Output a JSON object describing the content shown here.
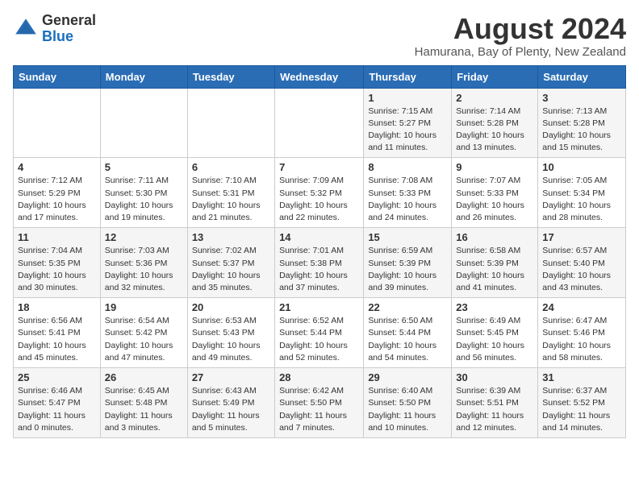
{
  "header": {
    "logo_general": "General",
    "logo_blue": "Blue",
    "month_title": "August 2024",
    "subtitle": "Hamurana, Bay of Plenty, New Zealand"
  },
  "days_of_week": [
    "Sunday",
    "Monday",
    "Tuesday",
    "Wednesday",
    "Thursday",
    "Friday",
    "Saturday"
  ],
  "weeks": [
    [
      {
        "day": "",
        "info": ""
      },
      {
        "day": "",
        "info": ""
      },
      {
        "day": "",
        "info": ""
      },
      {
        "day": "",
        "info": ""
      },
      {
        "day": "1",
        "info": "Sunrise: 7:15 AM\nSunset: 5:27 PM\nDaylight: 10 hours\nand 11 minutes."
      },
      {
        "day": "2",
        "info": "Sunrise: 7:14 AM\nSunset: 5:28 PM\nDaylight: 10 hours\nand 13 minutes."
      },
      {
        "day": "3",
        "info": "Sunrise: 7:13 AM\nSunset: 5:28 PM\nDaylight: 10 hours\nand 15 minutes."
      }
    ],
    [
      {
        "day": "4",
        "info": "Sunrise: 7:12 AM\nSunset: 5:29 PM\nDaylight: 10 hours\nand 17 minutes."
      },
      {
        "day": "5",
        "info": "Sunrise: 7:11 AM\nSunset: 5:30 PM\nDaylight: 10 hours\nand 19 minutes."
      },
      {
        "day": "6",
        "info": "Sunrise: 7:10 AM\nSunset: 5:31 PM\nDaylight: 10 hours\nand 21 minutes."
      },
      {
        "day": "7",
        "info": "Sunrise: 7:09 AM\nSunset: 5:32 PM\nDaylight: 10 hours\nand 22 minutes."
      },
      {
        "day": "8",
        "info": "Sunrise: 7:08 AM\nSunset: 5:33 PM\nDaylight: 10 hours\nand 24 minutes."
      },
      {
        "day": "9",
        "info": "Sunrise: 7:07 AM\nSunset: 5:33 PM\nDaylight: 10 hours\nand 26 minutes."
      },
      {
        "day": "10",
        "info": "Sunrise: 7:05 AM\nSunset: 5:34 PM\nDaylight: 10 hours\nand 28 minutes."
      }
    ],
    [
      {
        "day": "11",
        "info": "Sunrise: 7:04 AM\nSunset: 5:35 PM\nDaylight: 10 hours\nand 30 minutes."
      },
      {
        "day": "12",
        "info": "Sunrise: 7:03 AM\nSunset: 5:36 PM\nDaylight: 10 hours\nand 32 minutes."
      },
      {
        "day": "13",
        "info": "Sunrise: 7:02 AM\nSunset: 5:37 PM\nDaylight: 10 hours\nand 35 minutes."
      },
      {
        "day": "14",
        "info": "Sunrise: 7:01 AM\nSunset: 5:38 PM\nDaylight: 10 hours\nand 37 minutes."
      },
      {
        "day": "15",
        "info": "Sunrise: 6:59 AM\nSunset: 5:39 PM\nDaylight: 10 hours\nand 39 minutes."
      },
      {
        "day": "16",
        "info": "Sunrise: 6:58 AM\nSunset: 5:39 PM\nDaylight: 10 hours\nand 41 minutes."
      },
      {
        "day": "17",
        "info": "Sunrise: 6:57 AM\nSunset: 5:40 PM\nDaylight: 10 hours\nand 43 minutes."
      }
    ],
    [
      {
        "day": "18",
        "info": "Sunrise: 6:56 AM\nSunset: 5:41 PM\nDaylight: 10 hours\nand 45 minutes."
      },
      {
        "day": "19",
        "info": "Sunrise: 6:54 AM\nSunset: 5:42 PM\nDaylight: 10 hours\nand 47 minutes."
      },
      {
        "day": "20",
        "info": "Sunrise: 6:53 AM\nSunset: 5:43 PM\nDaylight: 10 hours\nand 49 minutes."
      },
      {
        "day": "21",
        "info": "Sunrise: 6:52 AM\nSunset: 5:44 PM\nDaylight: 10 hours\nand 52 minutes."
      },
      {
        "day": "22",
        "info": "Sunrise: 6:50 AM\nSunset: 5:44 PM\nDaylight: 10 hours\nand 54 minutes."
      },
      {
        "day": "23",
        "info": "Sunrise: 6:49 AM\nSunset: 5:45 PM\nDaylight: 10 hours\nand 56 minutes."
      },
      {
        "day": "24",
        "info": "Sunrise: 6:47 AM\nSunset: 5:46 PM\nDaylight: 10 hours\nand 58 minutes."
      }
    ],
    [
      {
        "day": "25",
        "info": "Sunrise: 6:46 AM\nSunset: 5:47 PM\nDaylight: 11 hours\nand 0 minutes."
      },
      {
        "day": "26",
        "info": "Sunrise: 6:45 AM\nSunset: 5:48 PM\nDaylight: 11 hours\nand 3 minutes."
      },
      {
        "day": "27",
        "info": "Sunrise: 6:43 AM\nSunset: 5:49 PM\nDaylight: 11 hours\nand 5 minutes."
      },
      {
        "day": "28",
        "info": "Sunrise: 6:42 AM\nSunset: 5:50 PM\nDaylight: 11 hours\nand 7 minutes."
      },
      {
        "day": "29",
        "info": "Sunrise: 6:40 AM\nSunset: 5:50 PM\nDaylight: 11 hours\nand 10 minutes."
      },
      {
        "day": "30",
        "info": "Sunrise: 6:39 AM\nSunset: 5:51 PM\nDaylight: 11 hours\nand 12 minutes."
      },
      {
        "day": "31",
        "info": "Sunrise: 6:37 AM\nSunset: 5:52 PM\nDaylight: 11 hours\nand 14 minutes."
      }
    ]
  ]
}
